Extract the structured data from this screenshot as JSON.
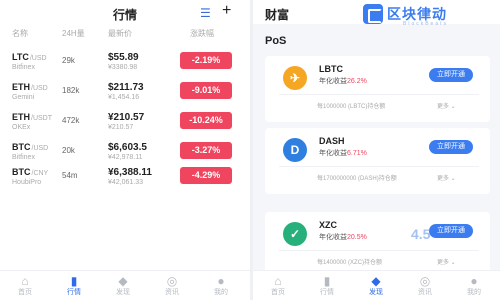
{
  "market": {
    "title": "行情",
    "columns": [
      "名称",
      "24H量",
      "最新价",
      "涨跌幅"
    ],
    "rows": [
      {
        "coin": "LTC",
        "quote": "/USD",
        "exchange": "Bitfinex",
        "volume": "29k",
        "price": "$55.89",
        "fiat": "¥3380.98",
        "change": "-2.19%"
      },
      {
        "coin": "ETH",
        "quote": "/USD",
        "exchange": "Gemini",
        "volume": "182k",
        "price": "$211.73",
        "fiat": "¥1,454.16",
        "change": "-9.01%"
      },
      {
        "coin": "ETH",
        "quote": "/USDT",
        "exchange": "OKEx",
        "volume": "472k",
        "price": "¥210.57",
        "fiat": "¥210.57",
        "change": "-10.24%"
      },
      {
        "coin": "BTC",
        "quote": "/USD",
        "exchange": "Bitfinex",
        "volume": "20k",
        "price": "$6,603.5",
        "fiat": "¥42,978.11",
        "change": "-3.27%"
      },
      {
        "coin": "BTC",
        "quote": "/CNY",
        "exchange": "HoubiPro",
        "volume": "54m",
        "price": "¥6,388.11",
        "fiat": "¥42,061.33",
        "change": "-4.29%"
      }
    ],
    "tabs": [
      {
        "icon": "home-icon",
        "glyph": "⌂",
        "label": "首页"
      },
      {
        "icon": "market-icon",
        "glyph": "▮",
        "label": "行情"
      },
      {
        "icon": "diamond-icon",
        "glyph": "◆",
        "label": "发现"
      },
      {
        "icon": "compass-icon",
        "glyph": "◎",
        "label": "资讯"
      },
      {
        "icon": "user-icon",
        "glyph": "●",
        "label": "我的"
      }
    ]
  },
  "wealth": {
    "title": "财富",
    "logo_text": "区块律动",
    "logo_sub": "BlockBeats",
    "section": "PoS",
    "cards": [
      {
        "name": "LBTC",
        "yield_label": "年化收益",
        "yield_value": "26.2%",
        "button": "立即开通",
        "min": "每1000000 (LBTC)持仓额",
        "more": "更多",
        "color": "#f5a623",
        "glyph": "✈"
      },
      {
        "name": "DASH",
        "yield_label": "年化收益",
        "yield_value": "6.71%",
        "button": "立即开通",
        "min": "每1700000000 (DASH)持仓额",
        "more": "更多",
        "color": "#2f7fe0",
        "glyph": "D"
      },
      {
        "name": "XZC",
        "yield_label": "年化收益",
        "yield_value": "20.5%",
        "button": "立即开通",
        "min": "每1400000 (XZC)持仓额",
        "more": "更多",
        "color": "#28b07a",
        "glyph": "✓"
      }
    ],
    "tabs": [
      {
        "icon": "home-icon",
        "glyph": "⌂",
        "label": "首页"
      },
      {
        "icon": "market-icon",
        "glyph": "▮",
        "label": "行情"
      },
      {
        "icon": "diamond-icon",
        "glyph": "◆",
        "label": "发现"
      },
      {
        "icon": "compass-icon",
        "glyph": "◎",
        "label": "资讯"
      },
      {
        "icon": "user-icon",
        "glyph": "●",
        "label": "我的"
      }
    ],
    "watermark": "4.5"
  }
}
